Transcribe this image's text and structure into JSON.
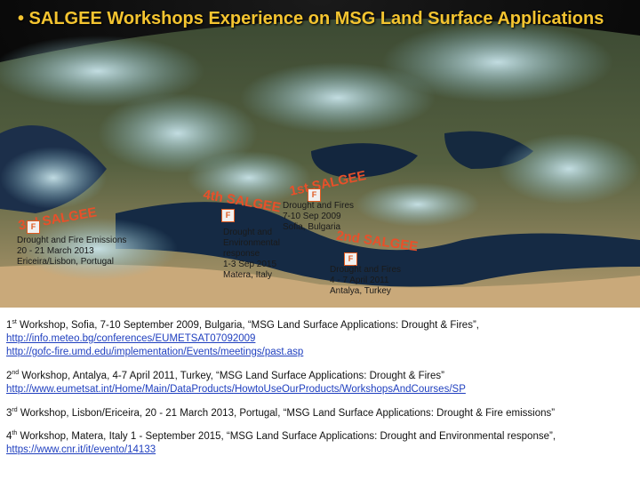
{
  "title": "• SALGEE Workshops  Experience on MSG Land Surface Applications",
  "stamps": {
    "first": "1st SALGEE",
    "second": "2nd SALGEE",
    "third": "3rd SALGEE",
    "fourth": "4th SALGEE"
  },
  "map_labels": {
    "portugal": [
      "Drought and Fire Emissions",
      "20 - 21 March 2013",
      "Ericeira/Lisbon, Portugal"
    ],
    "italy": [
      "Drought and",
      "Environmental",
      "response",
      "1-3 Sep 2015",
      "Matera, Italy"
    ],
    "bulgaria": [
      "Drought and Fires",
      "7-10 Sep 2009",
      "Sofia, Bulgaria"
    ],
    "turkey": [
      "Drought and Fires",
      "4 - 7 April 2011",
      "Antalya, Turkey"
    ]
  },
  "refs": {
    "w1_num": "1",
    "w1_sup": "st",
    "w1_text": " Workshop, Sofia, 7-10 September 2009, Bulgaria, “MSG Land Surface Applications: Drought & Fires”,",
    "w1_link1": "http://info.meteo.bg/conferences/EUMETSAT07092009",
    "w1_link2": "http://gofc-fire.umd.edu/implementation/Events/meetings/past.asp",
    "w2_num": "2",
    "w2_sup": "nd",
    "w2_text": " Workshop, Antalya, 4-7 April 2011, Turkey, “MSG Land Surface Applications: Drought & Fires”",
    "w2_link": "http://www.eumetsat.int/Home/Main/DataProducts/HowtoUseOurProducts/WorkshopsAndCourses/SP",
    "w3_num": "3",
    "w3_sup": "rd",
    "w3_text": " Workshop, Lisbon/Ericeira, 20 - 21 March 2013, Portugal, “MSG Land Surface Applications: Drought & Fire emissions”",
    "w4_num": "4",
    "w4_sup": "th",
    "w4_text": " Workshop, Matera, Italy 1 - September 2015, “MSG Land Surface Applications: Drought and Environmental response”, ",
    "w4_link": "https://www.cnr.it/it/evento/14133"
  }
}
